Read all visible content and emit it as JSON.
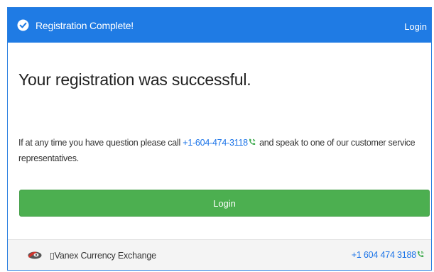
{
  "header": {
    "title": "Registration Complete!",
    "login_label": "Login"
  },
  "main": {
    "headline": "Your registration was successful.",
    "message_before": "If at any time you have question please call ",
    "phone": "+1-604-474-3118",
    "message_after": " and speak to one of our customer service representatives.",
    "login_button_label": "Login"
  },
  "footer": {
    "brand_name": "▯Vanex Currency Exchange",
    "phone": "+1 604 474 3188"
  },
  "colors": {
    "header_bg": "#1f7be4",
    "button_bg": "#4caf50",
    "link": "#1a73e8",
    "phone_icon": "#3aa84a"
  },
  "icons": {
    "header": "check-circle-icon",
    "phone": "phone-icon",
    "logo": "brand-logo"
  }
}
